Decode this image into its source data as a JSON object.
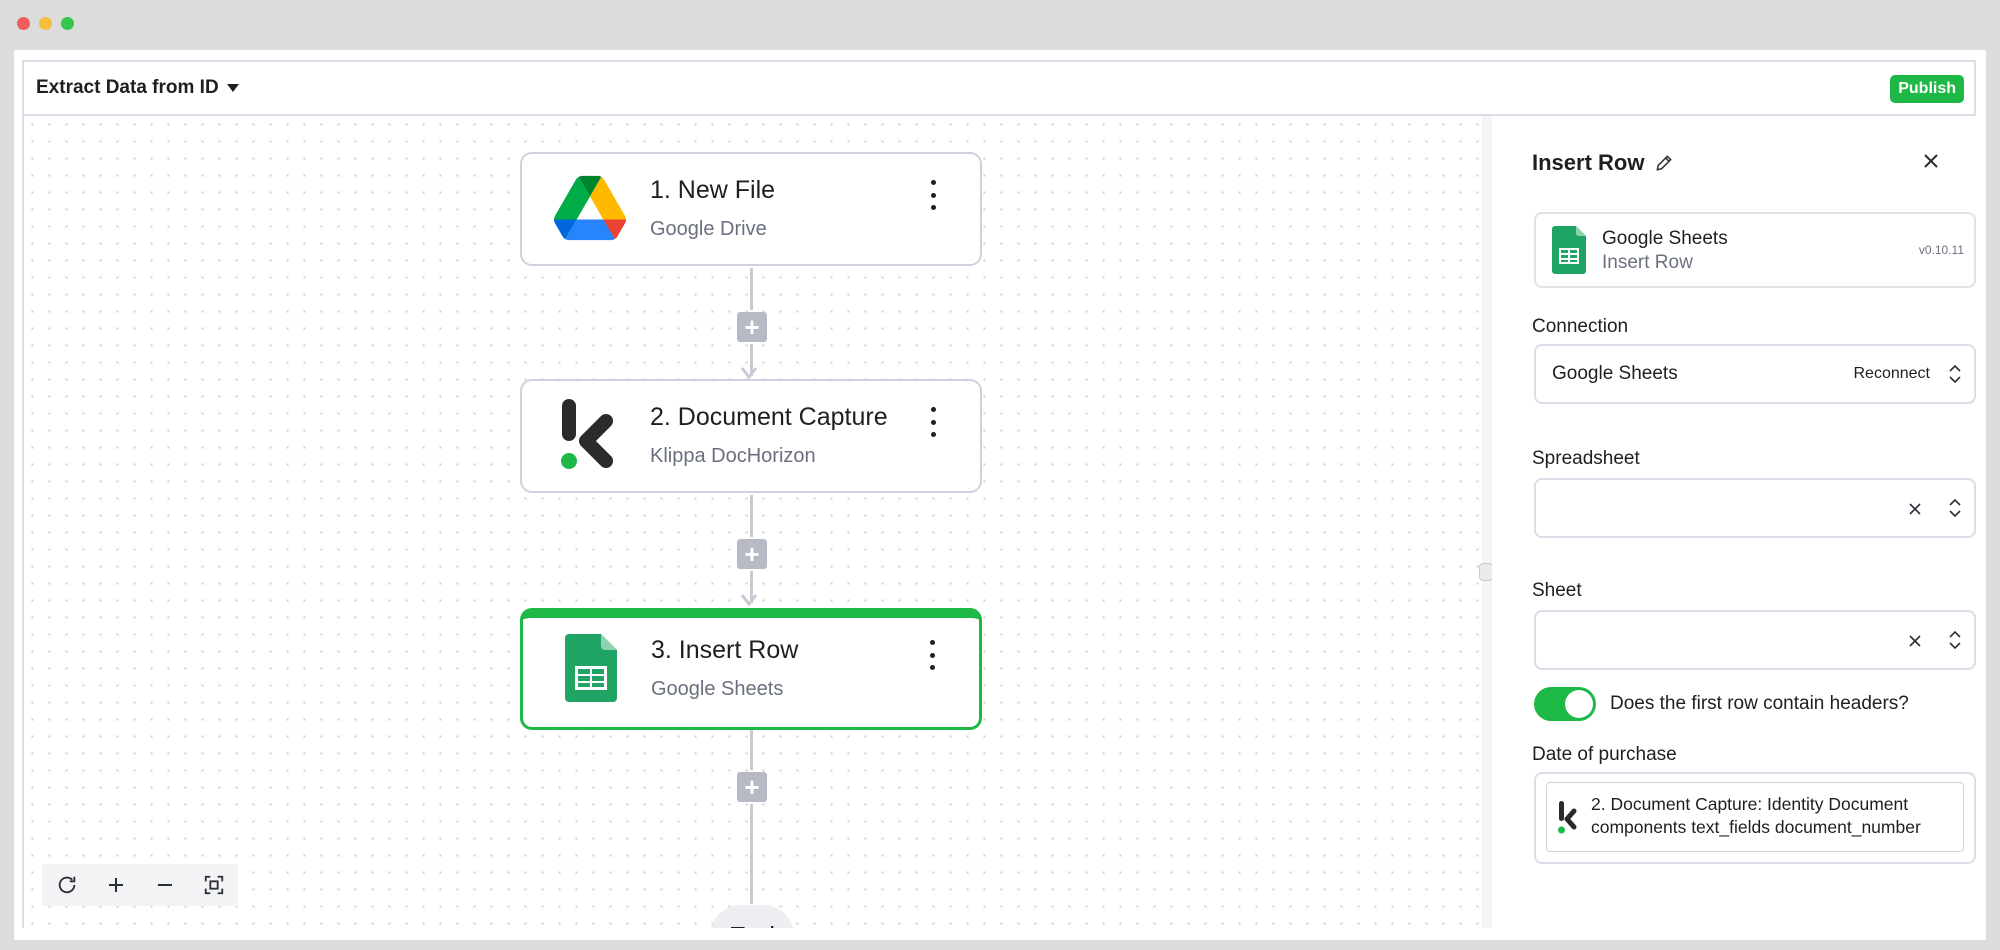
{
  "window": {
    "traffic_lights": [
      "#ee5f5a",
      "#f5be3b",
      "#37c64c"
    ]
  },
  "header": {
    "flow_title": "Extract Data from ID",
    "publish_label": "Publish"
  },
  "canvas": {
    "steps": [
      {
        "title": "1. New File",
        "subtitle": "Google Drive",
        "icon": "google-drive-icon"
      },
      {
        "title": "2. Document Capture",
        "subtitle": "Klippa DocHorizon",
        "icon": "klippa-icon"
      },
      {
        "title": "3. Insert Row",
        "subtitle": "Google Sheets",
        "icon": "google-sheets-icon"
      }
    ],
    "add_step_symbol": "+",
    "end_label": "End",
    "zoom_controls": [
      "refresh-icon",
      "zoom-in-icon",
      "zoom-out-icon",
      "fit-view-icon"
    ]
  },
  "panel": {
    "title": "Insert Row",
    "piece": {
      "name": "Google Sheets",
      "action": "Insert Row",
      "version": "v0.10.11"
    },
    "connection": {
      "label": "Connection",
      "value": "Google Sheets",
      "reconnect": "Reconnect"
    },
    "spreadsheet": {
      "label": "Spreadsheet",
      "value": ""
    },
    "sheet": {
      "label": "Sheet",
      "value": ""
    },
    "headers_toggle": {
      "label": "Does the first row contain headers?",
      "on": true
    },
    "date_of_purchase": {
      "label": "Date of purchase",
      "chip_text": "2. Document Capture: Identity Document components text_fields document_number"
    }
  },
  "colors": {
    "accent": "#1eb847",
    "border": "#dcdde6",
    "muted": "#6b7080"
  }
}
